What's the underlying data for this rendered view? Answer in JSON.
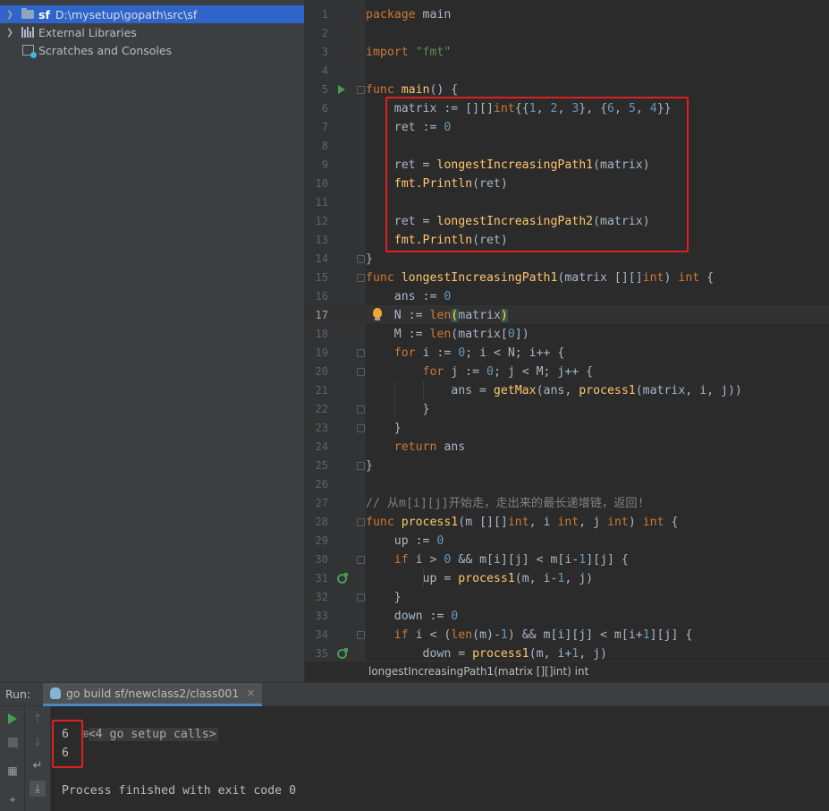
{
  "project": {
    "root": {
      "name": "sf",
      "path": "D:\\mysetup\\gopath\\src\\sf"
    },
    "external_libraries": "External Libraries",
    "scratches": "Scratches and Consoles"
  },
  "editor": {
    "current_line": 17,
    "lines": [
      {
        "n": "1",
        "html": "<span class=\"kw\">package</span> main"
      },
      {
        "n": "2",
        "html": ""
      },
      {
        "n": "3",
        "html": "<span class=\"kw\">import</span> <span class=\"str\">\"fmt\"</span>"
      },
      {
        "n": "4",
        "html": ""
      },
      {
        "n": "5",
        "html": "<span class=\"kw\">func</span> <span class=\"fn\">main</span>() {"
      },
      {
        "n": "6",
        "html": "    matrix := [][]<span class=\"kw\">int</span>{{<span class=\"num\">1</span>, <span class=\"num\">2</span>, <span class=\"num\">3</span>}, {<span class=\"num\">6</span>, <span class=\"num\">5</span>, <span class=\"num\">4</span>}}"
      },
      {
        "n": "7",
        "html": "    ret := <span class=\"num\">0</span>"
      },
      {
        "n": "8",
        "html": ""
      },
      {
        "n": "9",
        "html": "    ret = <span class=\"pkgfn\">longestIncreasingPath1</span>(matrix)"
      },
      {
        "n": "10",
        "html": "    <span class=\"pkgfn\">fmt.Println</span>(ret)"
      },
      {
        "n": "11",
        "html": ""
      },
      {
        "n": "12",
        "html": "    ret = <span class=\"pkgfn\">longestIncreasingPath2</span>(matrix)"
      },
      {
        "n": "13",
        "html": "    <span class=\"pkgfn\">fmt.Println</span>(ret)"
      },
      {
        "n": "14",
        "html": "}"
      },
      {
        "n": "15",
        "html": "<span class=\"kw\">func</span> <span class=\"fn\">longestIncreasingPath1</span>(matrix [][]<span class=\"kw\">int</span>) <span class=\"kw\">int</span> {"
      },
      {
        "n": "16",
        "html": "    ans := <span class=\"num\">0</span>"
      },
      {
        "n": "17",
        "html": "    N := <span class=\"kw\">len</span><span class=\"brmatch\">(</span>matrix<span class=\"brmatch\">)</span>"
      },
      {
        "n": "18",
        "html": "    M := <span class=\"kw\">len</span>(matrix[<span class=\"num\">0</span>])"
      },
      {
        "n": "19",
        "html": "    <span class=\"kw\">for</span> i := <span class=\"num\">0</span>; i &lt; N; i++ {"
      },
      {
        "n": "20",
        "html": "        <span class=\"kw\">for</span> j := <span class=\"num\">0</span>; j &lt; M; j++ {"
      },
      {
        "n": "21",
        "html": "            ans = <span class=\"pkgfn\">getMax</span>(ans, <span class=\"pkgfn\">process1</span>(matrix, i, j))"
      },
      {
        "n": "22",
        "html": "        }"
      },
      {
        "n": "23",
        "html": "    }"
      },
      {
        "n": "24",
        "html": "    <span class=\"kw\">return</span> ans"
      },
      {
        "n": "25",
        "html": "}"
      },
      {
        "n": "26",
        "html": ""
      },
      {
        "n": "27",
        "html": "<span class=\"cm\">// 从m[i][j]开始走，走出来的最长递增链，返回!</span>"
      },
      {
        "n": "28",
        "html": "<span class=\"kw\">func</span> <span class=\"fn\">process1</span>(m [][]<span class=\"kw\">int</span>, i <span class=\"kw\">int</span>, j <span class=\"kw\">int</span>) <span class=\"kw\">int</span> {"
      },
      {
        "n": "29",
        "html": "    up := <span class=\"num\">0</span>"
      },
      {
        "n": "30",
        "html": "    <span class=\"kw\">if</span> i &gt; <span class=\"num\">0</span> &amp;&amp; m[i][j] &lt; m[i-<span class=\"num\">1</span>][j] {"
      },
      {
        "n": "31",
        "html": "        up = <span class=\"pkgfn\">process1</span>(m, i-<span class=\"num\">1</span>, j)"
      },
      {
        "n": "32",
        "html": "    }"
      },
      {
        "n": "33",
        "html": "    down := <span class=\"num\">0</span>"
      },
      {
        "n": "34",
        "html": "    <span class=\"kw\">if</span> i &lt; (<span class=\"kw\">len</span>(m)-<span class=\"num\">1</span>) &amp;&amp; m[i][j] &lt; m[i+<span class=\"num\">1</span>][j] {"
      },
      {
        "n": "35",
        "html": "        down = <span class=\"pkgfn\">process1</span>(m, i+<span class=\"num\">1</span>, j)"
      }
    ],
    "breadcrumb": "longestIncreasingPath1(matrix [][]int) int"
  },
  "run": {
    "label": "Run:",
    "tab_title": "go build sf/newclass2/class001",
    "tab_close": "×",
    "console": {
      "setup_calls": "<4 go setup calls>",
      "outputs": [
        "6",
        "6"
      ],
      "finished": "Process finished with exit code 0"
    }
  },
  "colors": {
    "keyword": "#cc7832",
    "number": "#6897bb",
    "string": "#6a8759",
    "function": "#ffc66d",
    "comment": "#808080",
    "highlight_box": "#e02020"
  }
}
